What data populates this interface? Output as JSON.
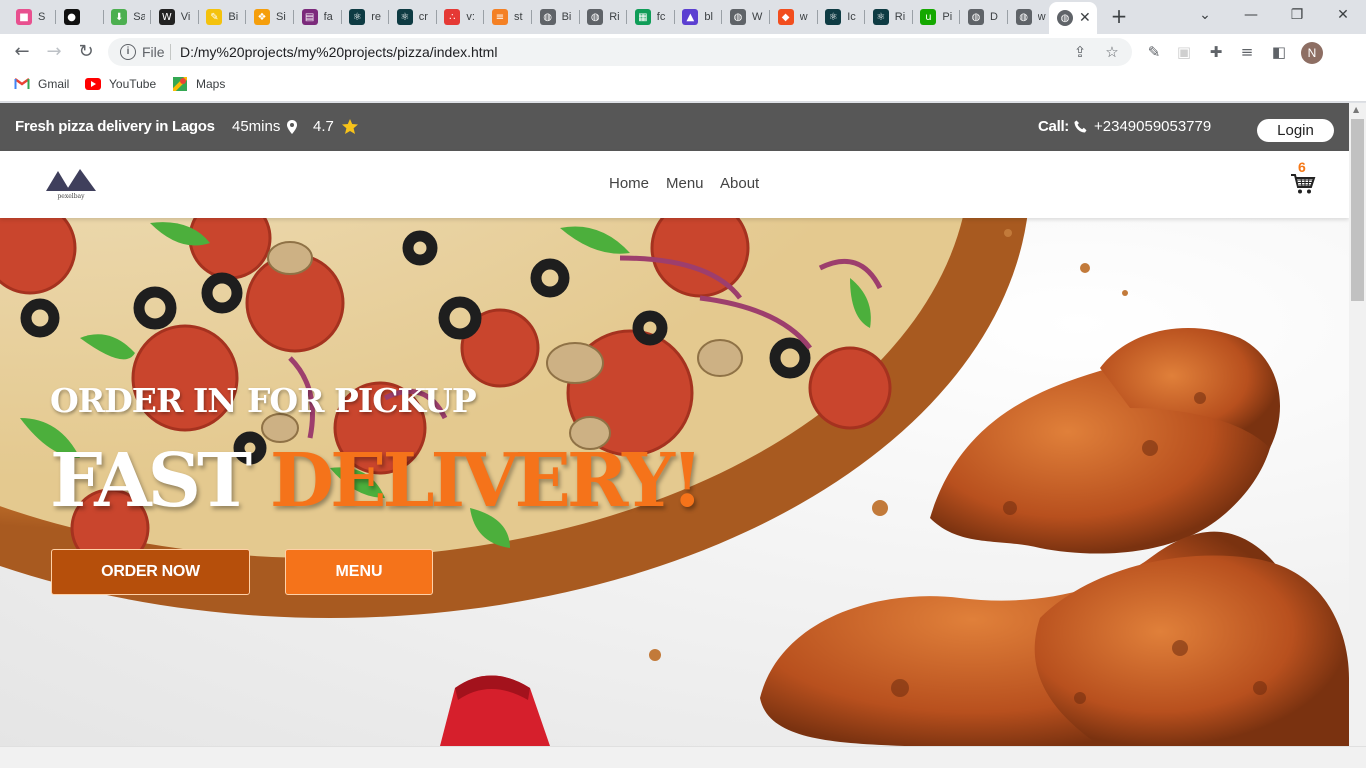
{
  "browser": {
    "tabs": [
      {
        "label": "S",
        "icon": "pink-square-icon",
        "color": "#e8508f"
      },
      {
        "label": "",
        "icon": "github-icon",
        "color": "#111111"
      },
      {
        "label": "Sa",
        "icon": "download-icon",
        "color": "#4caf50"
      },
      {
        "label": "Vi",
        "icon": "webflow-icon",
        "color": "#222222"
      },
      {
        "label": "Bi",
        "icon": "pencil-icon",
        "color": "#f4c20d"
      },
      {
        "label": "Si",
        "icon": "paw-icon",
        "color": "#f59e0b"
      },
      {
        "label": "fa",
        "icon": "form-icon",
        "color": "#7b2a7b"
      },
      {
        "label": "re",
        "icon": "react-native-icon",
        "color": "#0e3b43"
      },
      {
        "label": "cr",
        "icon": "react-icon",
        "color": "#0e3b43"
      },
      {
        "label": "v:",
        "icon": "dots-icon",
        "color": "#e53935"
      },
      {
        "label": "st",
        "icon": "stackoverflow-icon",
        "color": "#f48024"
      },
      {
        "label": "Bi",
        "icon": "globe-icon",
        "color": "#5f6368"
      },
      {
        "label": "Ri",
        "icon": "globe-icon",
        "color": "#5f6368"
      },
      {
        "label": "fc",
        "icon": "sheets-icon",
        "color": "#0f9d58"
      },
      {
        "label": "bl",
        "icon": "arc-icon",
        "color": "#5b3fd1"
      },
      {
        "label": "W",
        "icon": "globe-icon",
        "color": "#5f6368"
      },
      {
        "label": "w",
        "icon": "figma-icon",
        "color": "#f24e1e"
      },
      {
        "label": "Ic",
        "icon": "react-icon",
        "color": "#0e3b43"
      },
      {
        "label": "Ri",
        "icon": "react-icon",
        "color": "#0e3b43"
      },
      {
        "label": "Pi",
        "icon": "upwork-icon",
        "color": "#14a800"
      },
      {
        "label": "D",
        "icon": "globe-icon",
        "color": "#5f6368"
      },
      {
        "label": "w",
        "icon": "globe-icon",
        "color": "#5f6368"
      }
    ],
    "active_tab_close": "✕",
    "address": {
      "scheme": "File",
      "url": "D:/my%20projects/my%20projects/pizza/index.html"
    },
    "profile_initial": "N",
    "bookmarks": [
      {
        "label": "Gmail",
        "icon": "gmail-icon"
      },
      {
        "label": "YouTube",
        "icon": "youtube-icon"
      },
      {
        "label": "Maps",
        "icon": "maps-icon"
      }
    ]
  },
  "site": {
    "topbar": {
      "tagline": "Fresh pizza delivery in Lagos",
      "delivery_time": "45mins",
      "rating": "4.7",
      "call_label": "Call:",
      "phone": "+2349059053779",
      "login_label": "Login"
    },
    "nav": {
      "logo_text": "pexelbay",
      "links": [
        "Home",
        "Menu",
        "About"
      ],
      "cart_count": "6"
    },
    "hero": {
      "subtitle": "ORDER IN FOR PICKUP",
      "title_word1": "FAST",
      "title_word2": "DELIVERY!",
      "order_button": "ORDER NOW",
      "menu_button": "MENU"
    },
    "colors": {
      "accent": "#f5731a",
      "accent_dark": "#b64f0b",
      "topbar_bg": "#575757",
      "star": "#f7c31a"
    }
  }
}
